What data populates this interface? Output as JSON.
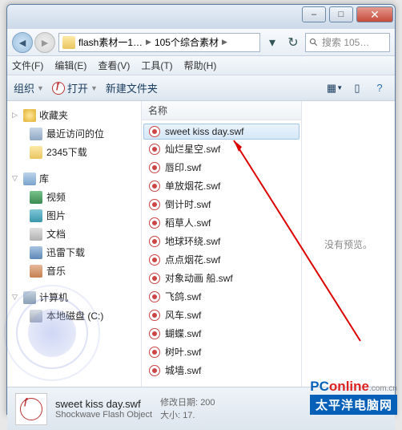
{
  "window": {
    "minimize": "–",
    "maximize": "□",
    "close": "✕"
  },
  "address": {
    "seg1": "flash素材一1…",
    "seg2": "105个综合素材",
    "refresh_drop": "▾"
  },
  "search": {
    "placeholder": "搜索 105…"
  },
  "menu": {
    "file": "文件(F)",
    "edit": "编辑(E)",
    "view": "查看(V)",
    "tools": "工具(T)",
    "help": "帮助(H)"
  },
  "toolbar": {
    "organize": "组织",
    "open": "打开",
    "newfolder": "新建文件夹"
  },
  "tree": {
    "favorites": "收藏夹",
    "recent": "最近访问的位",
    "dl2345": "2345下载",
    "libraries": "库",
    "videos": "视频",
    "pictures": "图片",
    "documents": "文档",
    "thunder": "迅雷下载",
    "music": "音乐",
    "computer": "计算机",
    "diskc": "本地磁盘 (C:)"
  },
  "column": {
    "name": "名称"
  },
  "files": [
    "sweet kiss day.swf",
    "灿烂星空.swf",
    "唇印.swf",
    "单放烟花.swf",
    "倒计时.swf",
    "稻草人.swf",
    "地球环绕.swf",
    "点点烟花.swf",
    "对象动画 船.swf",
    "飞鸽.swf",
    "风车.swf",
    "蝴蝶.swf",
    "树叶.swf",
    "城墙.swf"
  ],
  "preview": {
    "empty": "没有预览。"
  },
  "status": {
    "filename": "sweet kiss day.swf",
    "filetype": "Shockwave Flash Object",
    "modlabel": "修改日期:",
    "modval": "200",
    "sizelabel": "大小:",
    "sizeval": "17."
  },
  "watermark": {
    "brand_pc": "PC",
    "brand_online": "online",
    "brand_cn": ".com.cn",
    "tagline": "太平洋电脑网"
  }
}
